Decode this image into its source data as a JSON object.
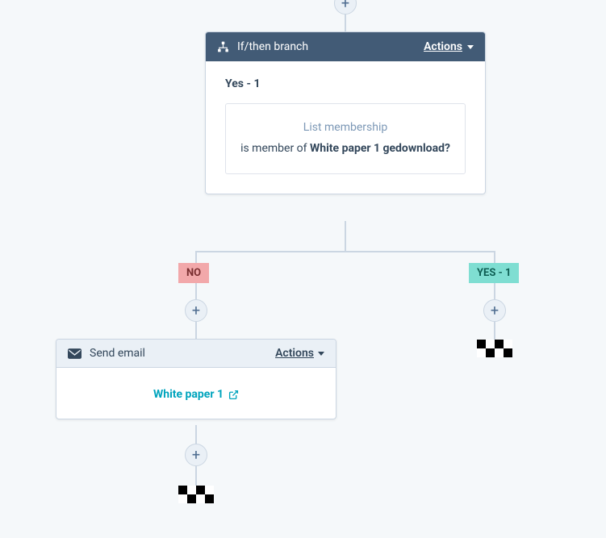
{
  "branch": {
    "header_label": "If/then branch",
    "actions_label": "Actions",
    "title": "Yes - 1",
    "condition_type": "List membership",
    "condition_prefix": "is member of ",
    "condition_value": "White paper 1 gedownload?"
  },
  "labels": {
    "no": "NO",
    "yes": "YES - 1"
  },
  "email": {
    "header_label": "Send email",
    "actions_label": "Actions",
    "link_text": "White paper 1"
  }
}
